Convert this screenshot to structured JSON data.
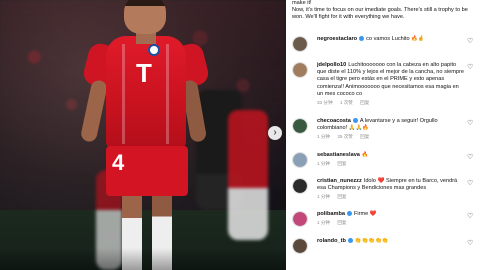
{
  "caption": {
    "line1": "make it!",
    "line2": "Now, it's time to focus on our imediate goals. There's still a trophy to be won. We'll fight for it with everything we have."
  },
  "jersey": {
    "number": "4",
    "logo": "T"
  },
  "nav": {
    "next_icon": "chevron-right"
  },
  "comments": [
    {
      "user": "negroestaclaro",
      "text": "co vamos Luchito",
      "extra": "🔥🤞",
      "time": "",
      "likes": "",
      "reply": "",
      "avatar_color": "#6b5b4b"
    },
    {
      "user": "jdelpollo10",
      "text": "Luchitooooooo con la cabeza en alto papito que diste el 110% y lejos el mejor de la cancha, no siempre casa el tigre pero estás en el PRIME y esto apenas comienza!! Animooooooo que necesitamos esa magia en un mes cococo co",
      "extra": "",
      "time": "33 分钟",
      "likes": "1 次赞",
      "reply": "回复",
      "avatar_color": "#a07d5e"
    },
    {
      "user": "checoacosta",
      "text": "A levantarse y a seguir! Orgullo colombiano!",
      "extra": "🙏🙏🔥",
      "time": "1 分钟",
      "likes": "25 次赞",
      "reply": "回复",
      "avatar_color": "#3a5a40"
    },
    {
      "user": "sebastianeslava",
      "text": "",
      "extra": "🔥",
      "time": "1 分钟",
      "likes": "",
      "reply": "回复",
      "avatar_color": "#8aa0b6"
    },
    {
      "user": "cristian_nunezzz",
      "text": "Idolo ❤️ Siempre en tu Barco, vendrá esa Champions y Bendiciones mas grandes",
      "extra": "",
      "time": "1 分钟",
      "likes": "",
      "reply": "回复",
      "avatar_color": "#2b2b2b"
    },
    {
      "user": "polibamba",
      "text": "Firme",
      "extra": "❤️",
      "time": "1 分钟",
      "likes": "",
      "reply": "回复",
      "avatar_color": "#c2477a"
    },
    {
      "user": "rolando_tb",
      "text": "",
      "extra": "👏👏👏👏👏",
      "time": "",
      "likes": "",
      "reply": "",
      "avatar_color": "#5b4a3c"
    }
  ]
}
